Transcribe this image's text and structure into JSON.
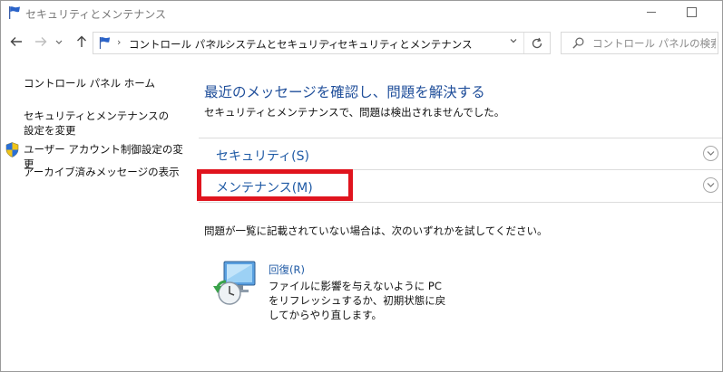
{
  "window": {
    "title": "セキュリティとメンテナンス"
  },
  "nav": {
    "breadcrumbs": [
      "コントロール パネル",
      "システムとセキュリティ",
      "セキュリティとメンテナンス"
    ],
    "search_placeholder": "コントロール パネルの検索"
  },
  "sidebar": {
    "home": "コントロール パネル ホーム",
    "settings": "セキュリティとメンテナンスの設定を変更",
    "uac": "ユーザー アカウント制御設定の変更",
    "archive": "アーカイブ済みメッセージの表示"
  },
  "main": {
    "title": "最近のメッセージを確認し、問題を解決する",
    "subtitle": "セキュリティとメンテナンスで、問題は検出されませんでした。",
    "sections": [
      {
        "label": "セキュリティ(S)"
      },
      {
        "label": "メンテナンス(M)"
      }
    ],
    "hint": "問題が一覧に記載されていない場合は、次のいずれかを試してください。",
    "recovery": {
      "link": "回復(R)",
      "description": "ファイルに影響を与えないように PC をリフレッシュするか、初期状態に戻してからやり直します。"
    }
  },
  "colors": {
    "link": "#1f5aa5",
    "title": "#1f4e9a",
    "highlight": "#e0141e"
  }
}
